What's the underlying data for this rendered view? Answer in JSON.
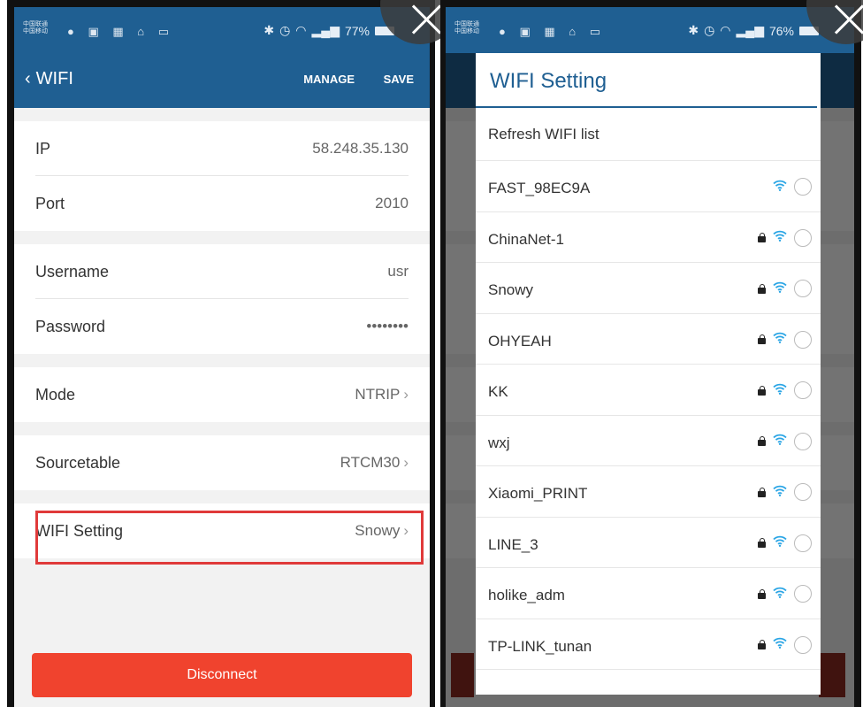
{
  "left_screen": {
    "status": {
      "carrier": "中国联通\n中国移动",
      "battery": "77%"
    },
    "appbar": {
      "title": "WIFI",
      "manage_label": "MANAGE",
      "save_label": "SAVE"
    },
    "fields": {
      "ip": {
        "label": "IP",
        "value": "58.248.35.130"
      },
      "port": {
        "label": "Port",
        "value": "2010"
      },
      "username": {
        "label": "Username",
        "value": "usr"
      },
      "password": {
        "label": "Password",
        "value": "••••••••"
      },
      "mode": {
        "label": "Mode",
        "value": "NTRIP"
      },
      "sourcetable": {
        "label": "Sourcetable",
        "value": "RTCM30"
      },
      "wifi": {
        "label": "WIFI Setting",
        "value": "Snowy"
      }
    },
    "disconnect_label": "Disconnect"
  },
  "right_screen": {
    "status": {
      "battery": "76%"
    },
    "dialog": {
      "title": "WIFI Setting",
      "refresh_label": "Refresh WIFI list",
      "networks": [
        {
          "name": "FAST_98EC9A",
          "locked": false
        },
        {
          "name": "ChinaNet-1",
          "locked": true
        },
        {
          "name": "Snowy",
          "locked": true
        },
        {
          "name": "OHYEAH",
          "locked": true
        },
        {
          "name": "KK",
          "locked": true
        },
        {
          "name": "wxj",
          "locked": true
        },
        {
          "name": "Xiaomi_PRINT",
          "locked": true
        },
        {
          "name": "LINE_3",
          "locked": true
        },
        {
          "name": "holike_adm",
          "locked": true
        },
        {
          "name": "TP-LINK_tunan",
          "locked": true
        }
      ]
    }
  },
  "colors": {
    "header": "#1f5f92",
    "accent_red": "#f0432e",
    "highlight": "#e03a3a",
    "wifi_icon": "#2aa5e5"
  }
}
